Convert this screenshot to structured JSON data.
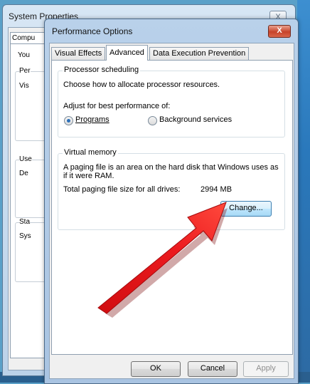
{
  "system_properties": {
    "title": "System Properties",
    "close_label": "X",
    "tab_label": "Compu",
    "text_you": "You",
    "group1_label": "Per",
    "group1_text": "Vis",
    "group2_label": "Use",
    "group2_text": "De",
    "group3_label": "Sta",
    "group3_text": "Sys"
  },
  "performance_options": {
    "title": "Performance Options",
    "close_label": "X",
    "tabs": [
      {
        "label": "Visual Effects",
        "active": false
      },
      {
        "label": "Advanced",
        "active": true
      },
      {
        "label": "Data Execution Prevention",
        "active": false
      }
    ],
    "processor_scheduling": {
      "label": "Processor scheduling",
      "description": "Choose how to allocate processor resources.",
      "adjust_label": "Adjust for best performance of:",
      "options": [
        {
          "label": "Programs",
          "selected": true
        },
        {
          "label": "Background services",
          "selected": false
        }
      ]
    },
    "virtual_memory": {
      "label": "Virtual memory",
      "description_line1": "A paging file is an area on the hard disk that Windows uses as",
      "description_line2": "if it were RAM.",
      "total_label": "Total paging file size for all drives:",
      "total_value": "2994 MB",
      "change_button": "Change..."
    },
    "buttons": {
      "ok": "OK",
      "cancel": "Cancel",
      "apply": "Apply"
    }
  },
  "annotation": {
    "arrow_color": "#e8161a",
    "arrow_target": "change-button"
  }
}
